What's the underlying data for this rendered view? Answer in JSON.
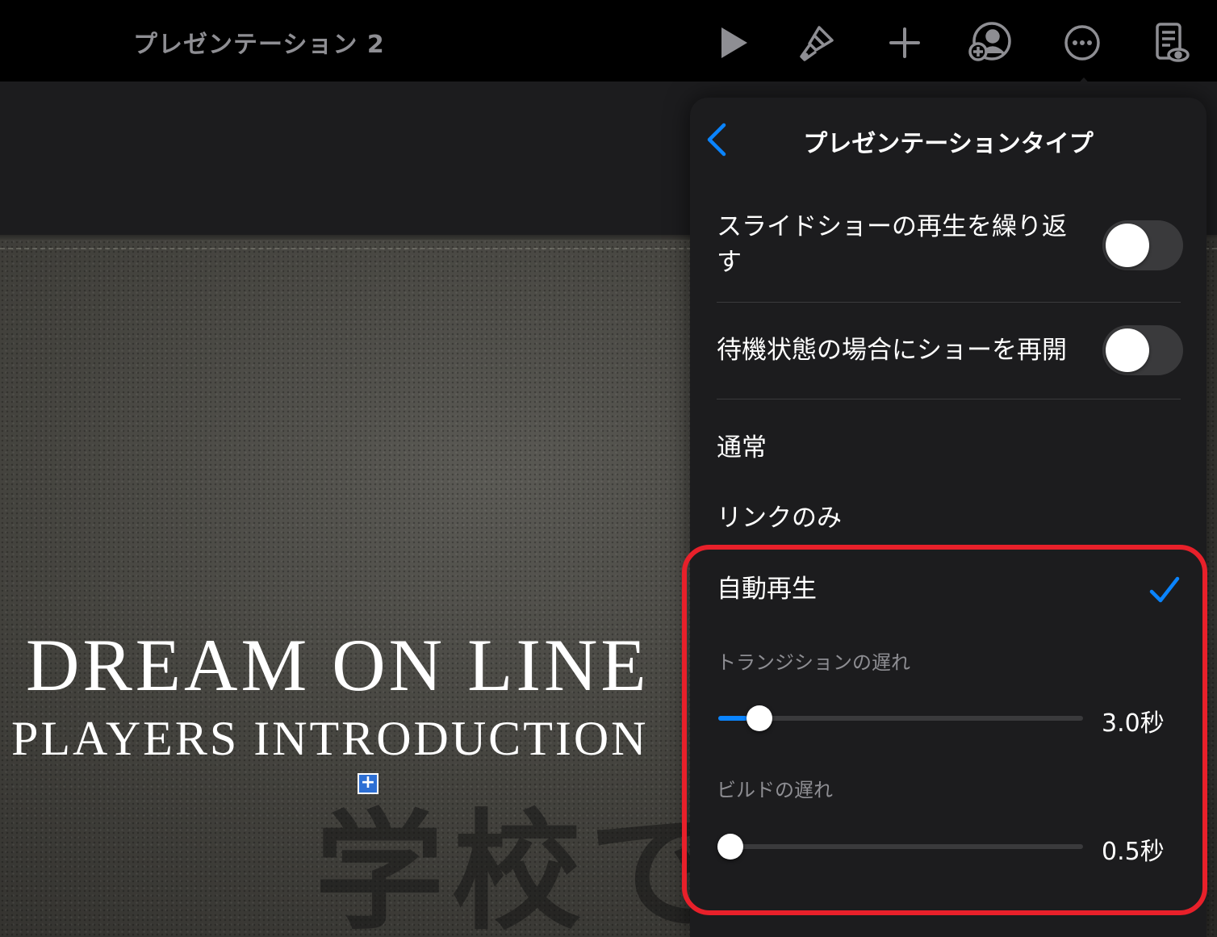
{
  "toolbar": {
    "doc_title": "プレゼンテーション 2",
    "icons": [
      "play-icon",
      "brush-icon",
      "plus-icon",
      "collaborate-icon",
      "more-icon",
      "presenter-notes-icon"
    ]
  },
  "slide": {
    "title": "DREAM ON LINE",
    "subtitle": "PLAYERS INTRODUCTION",
    "watermark": "学校でのICT"
  },
  "popover": {
    "title": "プレゼンテーションタイプ",
    "loop_label": "スライドショーの再生を繰り返す",
    "loop_on": false,
    "restart_idle_label": "待機状態の場合にショーを再開",
    "restart_idle_on": false,
    "options": [
      "通常",
      "リンクのみ",
      "自動再生"
    ],
    "selected_option": "自動再生",
    "transition_delay_label": "トランジションの遅れ",
    "transition_delay_value": "3.0秒",
    "transition_delay_fraction": 0.08,
    "build_delay_label": "ビルドの遅れ",
    "build_delay_value": "0.5秒",
    "build_delay_fraction": 0.0
  },
  "colors": {
    "accent": "#0a84ff",
    "highlight": "#e8202a",
    "toolbar_icon": "#8e8e93"
  }
}
